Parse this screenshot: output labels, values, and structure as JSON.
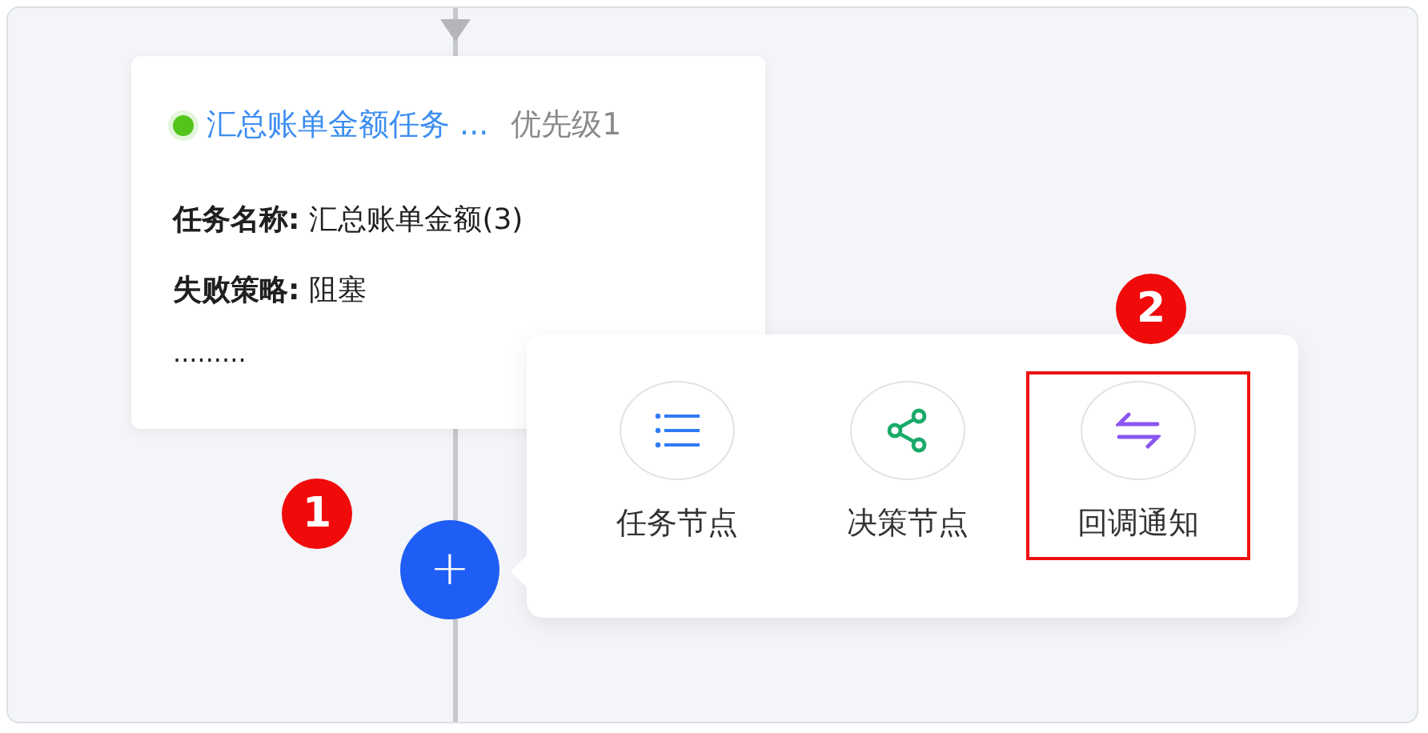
{
  "node": {
    "color": "#52c41a",
    "title": "汇总账单金额任务 ...",
    "priority": "优先级1",
    "fields": [
      {
        "label": "任务名称:",
        "value": "汇总账单金额(3)"
      },
      {
        "label": "失败策略:",
        "value": "阻塞"
      }
    ],
    "more": "........."
  },
  "add_button": {
    "symbol": "+"
  },
  "menu": {
    "items": [
      {
        "kind": "task",
        "label": "任务节点",
        "highlighted": false
      },
      {
        "kind": "decision",
        "label": "决策节点",
        "highlighted": false
      },
      {
        "kind": "callback",
        "label": "回调通知",
        "highlighted": true
      }
    ]
  },
  "callouts": [
    {
      "number": "1"
    },
    {
      "number": "2"
    }
  ]
}
